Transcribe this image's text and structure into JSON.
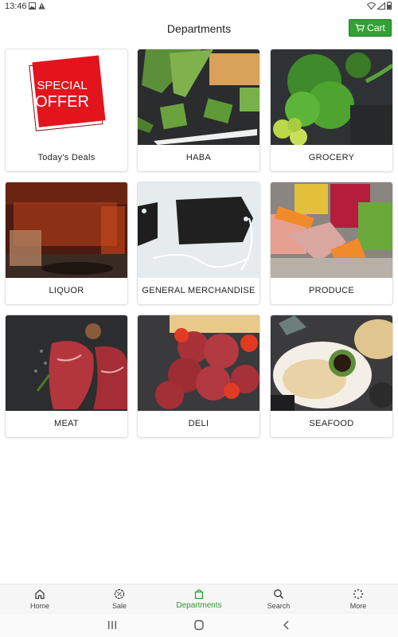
{
  "status_bar": {
    "time": "13:46"
  },
  "header": {
    "title": "Departments",
    "cart_label": "Cart"
  },
  "departments": [
    {
      "label": "Today's Deals",
      "offer_line1": "SPECIAL",
      "offer_line2": "OFFER"
    },
    {
      "label": "HABA"
    },
    {
      "label": "GROCERY"
    },
    {
      "label": "LIQUOR"
    },
    {
      "label": "GENERAL MERCHANDISE"
    },
    {
      "label": "PRODUCE"
    },
    {
      "label": "MEAT"
    },
    {
      "label": "DELI"
    },
    {
      "label": "SEAFOOD"
    }
  ],
  "bottom_nav": {
    "items": [
      {
        "label": "Home",
        "icon": "home-icon"
      },
      {
        "label": "Sale",
        "icon": "sale-icon"
      },
      {
        "label": "Departments",
        "icon": "departments-icon",
        "active": true
      },
      {
        "label": "Search",
        "icon": "search-icon"
      },
      {
        "label": "More",
        "icon": "more-icon"
      }
    ]
  },
  "colors": {
    "accent": "#33a133",
    "active_nav": "#2f9a2f",
    "offer_red": "#e3141c"
  }
}
